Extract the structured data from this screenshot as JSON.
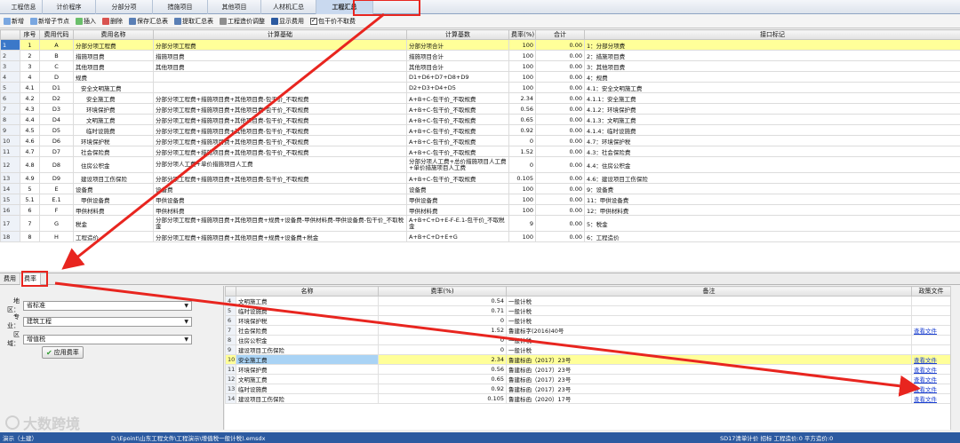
{
  "tabs": [
    "工程信息",
    "计价程序",
    "分部分项",
    "措施项目",
    "其他项目",
    "人材机汇总",
    "工程汇总"
  ],
  "active_tab": 6,
  "toolbar": {
    "add": "新增",
    "add_child": "新增子节点",
    "insert": "插入",
    "delete": "删除",
    "save_summary": "保存汇总表",
    "extract_summary": "提取汇总表",
    "adjust_cost": "工程造价调整",
    "show_fee": "显示费用",
    "exclude_fee": "包干价不取费"
  },
  "grid1": {
    "headers": [
      "序号",
      "费用代码",
      "费用名称",
      "计算基础",
      "计算基数",
      "费率(%)",
      "合计",
      "接口标记"
    ],
    "rows": [
      {
        "rn": "1",
        "no": "1",
        "code": "A",
        "name": "分部分项工程费",
        "basis": "分部分项工程费",
        "base": "分部分项合计",
        "rate": "100",
        "total": "0.00",
        "mark": "1：分部分项费"
      },
      {
        "rn": "2",
        "no": "2",
        "code": "B",
        "name": "措施项目费",
        "basis": "措施项目费",
        "base": "措施项目合计",
        "rate": "100",
        "total": "0.00",
        "mark": "2：措施项目费"
      },
      {
        "rn": "3",
        "no": "3",
        "code": "C",
        "name": "其他项目费",
        "basis": "其他项目费",
        "base": "其他项目合计",
        "rate": "100",
        "total": "0.00",
        "mark": "3：其他项目费"
      },
      {
        "rn": "4",
        "no": "4",
        "code": "D",
        "name": "规费",
        "basis": "",
        "base": "D1+D6+D7+D8+D9",
        "rate": "100",
        "total": "0.00",
        "mark": "4：规费"
      },
      {
        "rn": "5",
        "no": "4.1",
        "code": "D1",
        "name": "安全文明施工费",
        "basis": "",
        "base": "D2+D3+D4+D5",
        "rate": "100",
        "total": "0.00",
        "mark": "4.1：安全文明施工费"
      },
      {
        "rn": "6",
        "no": "4.2",
        "code": "D2",
        "name": "安全施工费",
        "basis": "分部分项工程费+措施项目费+其他项目费-包干价_不取规费",
        "base": "A+B+C-包干价_不取规费",
        "rate": "2.34",
        "total": "0.00",
        "mark": "4.1.1：安全施工费"
      },
      {
        "rn": "7",
        "no": "4.3",
        "code": "D3",
        "name": "环境保护费",
        "basis": "分部分项工程费+措施项目费+其他项目费-包干价_不取规费",
        "base": "A+B+C-包干价_不取规费",
        "rate": "0.56",
        "total": "0.00",
        "mark": "4.1.2：环境保护费"
      },
      {
        "rn": "8",
        "no": "4.4",
        "code": "D4",
        "name": "文明施工费",
        "basis": "分部分项工程费+措施项目费+其他项目费-包干价_不取规费",
        "base": "A+B+C-包干价_不取规费",
        "rate": "0.65",
        "total": "0.00",
        "mark": "4.1.3：文明施工费"
      },
      {
        "rn": "9",
        "no": "4.5",
        "code": "D5",
        "name": "临时设施费",
        "basis": "分部分项工程费+措施项目费+其他项目费-包干价_不取规费",
        "base": "A+B+C-包干价_不取规费",
        "rate": "0.92",
        "total": "0.00",
        "mark": "4.1.4：临时设施费"
      },
      {
        "rn": "10",
        "no": "4.6",
        "code": "D6",
        "name": "环境保护税",
        "basis": "分部分项工程费+措施项目费+其他项目费-包干价_不取规费",
        "base": "A+B+C-包干价_不取规费",
        "rate": "0",
        "total": "0.00",
        "mark": "4.7：环境保护税"
      },
      {
        "rn": "11",
        "no": "4.7",
        "code": "D7",
        "name": "社会保险费",
        "basis": "分部分项工程费+措施项目费+其他项目费-包干价_不取规费",
        "base": "A+B+C-包干价_不取规费",
        "rate": "1.52",
        "total": "0.00",
        "mark": "4.3：社会保险费"
      },
      {
        "rn": "12",
        "no": "4.8",
        "code": "D8",
        "name": "住房公积金",
        "basis": "分部分项人工费+单价措施项目人工费",
        "base": "分部分项人工费+总价措施项目人工费+单价措施项目人工费",
        "rate": "0",
        "total": "0.00",
        "mark": "4.4：住房公积金"
      },
      {
        "rn": "13",
        "no": "4.9",
        "code": "D9",
        "name": "建设项目工伤保险",
        "basis": "分部分项工程费+措施项目费+其他项目费-包干价_不取规费",
        "base": "A+B+C-包干价_不取规费",
        "rate": "0.105",
        "total": "0.00",
        "mark": "4.6：建设项目工伤保险"
      },
      {
        "rn": "14",
        "no": "5",
        "code": "E",
        "name": "设备费",
        "basis": "设备费",
        "base": "设备费",
        "rate": "100",
        "total": "0.00",
        "mark": "9：设备费"
      },
      {
        "rn": "15",
        "no": "5.1",
        "code": "E.1",
        "name": "甲供设备费",
        "basis": "甲供设备费",
        "base": "甲供设备费",
        "rate": "100",
        "total": "0.00",
        "mark": "11：甲供设备费"
      },
      {
        "rn": "16",
        "no": "6",
        "code": "F",
        "name": "甲供材料费",
        "basis": "甲供材料费",
        "base": "甲供材料费",
        "rate": "100",
        "total": "0.00",
        "mark": "12：甲供材料费"
      },
      {
        "rn": "17",
        "no": "7",
        "code": "G",
        "name": "税金",
        "basis": "分部分项工程费+措施项目费+其他项目费+规费+设备费-甲供材料费-甲供设备费-包干价_不取税金",
        "base": "A+B+C+D+E-F-E.1-包干价_不取税金",
        "rate": "9",
        "total": "0.00",
        "mark": "5：税金"
      },
      {
        "rn": "18",
        "no": "8",
        "code": "H",
        "name": "工程造价",
        "basis": "分部分项工程费+措施项目费+其他项目费+规费+设备费+税金",
        "base": "A+B+C+D+E+G",
        "rate": "100",
        "total": "0.00",
        "mark": "6：工程造价"
      }
    ]
  },
  "mid_tabs": [
    "费用",
    "费率"
  ],
  "left_panel": {
    "region_label": "地区：",
    "region_value": "省标准",
    "major_label": "专业：",
    "major_value": "建筑工程",
    "area_label": "区域：",
    "area_value": "增值税",
    "apply_label": "应用费率"
  },
  "grid2": {
    "headers": [
      "名称",
      "费率(%)",
      "备注",
      "政策文件"
    ],
    "rows": [
      {
        "rn": "4",
        "name": "文明施工费",
        "rate": "0.54",
        "note": "一般计税",
        "link": ""
      },
      {
        "rn": "5",
        "name": "临时设施费",
        "rate": "0.71",
        "note": "一般计税",
        "link": ""
      },
      {
        "rn": "6",
        "name": "环境保护税",
        "rate": "0",
        "note": "一般计税",
        "link": ""
      },
      {
        "rn": "7",
        "name": "社会保险费",
        "rate": "1.52",
        "note": "鲁建标字(2016)40号",
        "link": "查看文件"
      },
      {
        "rn": "8",
        "name": "住房公积金",
        "rate": "0",
        "note": "一般计税",
        "link": ""
      },
      {
        "rn": "9",
        "name": "建设项目工伤保险",
        "rate": "0",
        "note": "一般计税",
        "link": ""
      },
      {
        "rn": "10",
        "name": "安全施工费",
        "rate": "2.34",
        "note": "鲁建标函（2017）23号",
        "link": "查看文件"
      },
      {
        "rn": "11",
        "name": "环境保护费",
        "rate": "0.56",
        "note": "鲁建标函（2017）23号",
        "link": "查看文件"
      },
      {
        "rn": "12",
        "name": "文明施工费",
        "rate": "0.65",
        "note": "鲁建标函（2017）23号",
        "link": "查看文件"
      },
      {
        "rn": "13",
        "name": "临时设施费",
        "rate": "0.92",
        "note": "鲁建标函（2017）23号",
        "link": "查看文件"
      },
      {
        "rn": "14",
        "name": "建设项目工伤保险",
        "rate": "0.105",
        "note": "鲁建标函（2020）17号",
        "link": "查看文件"
      }
    ]
  },
  "status": {
    "left": "演示（土建）",
    "path": "D:\\Epoint\\山东工程文件\\工程演示\\增值税一般计税).emsdx",
    "right": "SD17清单计价 招标 工程造价:0 平方造价:0"
  },
  "watermark": "大数跨境",
  "colors": {
    "selected_row": "#ffff99",
    "row_marker": "#3b78c9",
    "arrow_red": "#e8251f",
    "status_bar": "#2c5aa0",
    "link": "#1a3fd1"
  }
}
